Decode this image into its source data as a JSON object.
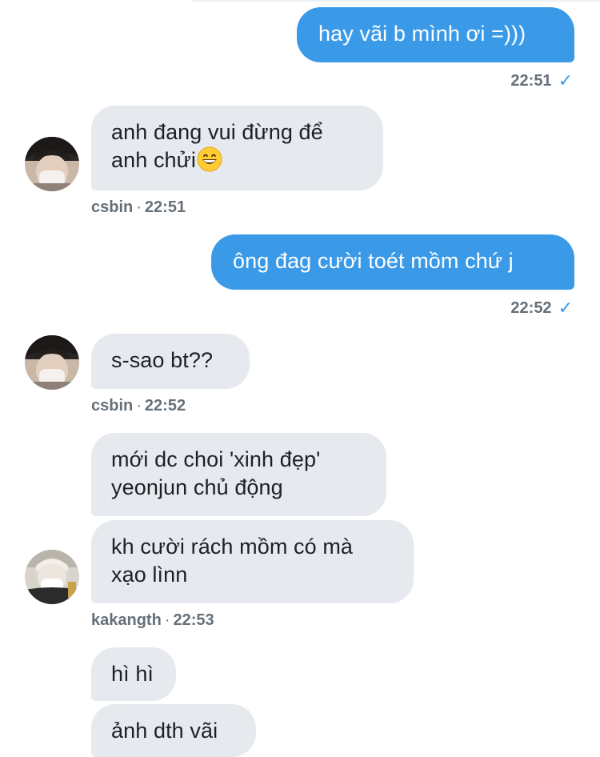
{
  "colors": {
    "outgoing_bubble": "#3b9ae8",
    "incoming_bubble": "#e6e9ee",
    "meta_text": "#667079",
    "read_check": "#3b9ae8"
  },
  "messages": [
    {
      "direction": "out",
      "text": "hay vãi b mình ơi =)))",
      "time": "22:51",
      "status_icon": "check-icon"
    },
    {
      "direction": "in",
      "line1": "anh đang vui đừng để",
      "line2": "anh chửi",
      "emoji": "grinning-face-emoji",
      "sender": "csbin",
      "time": "22:51",
      "separator": "·"
    },
    {
      "direction": "out",
      "text": "ông đag cười toét mồm chứ j",
      "time": "22:52",
      "status_icon": "check-icon"
    },
    {
      "direction": "in",
      "text": "s-sao bt??",
      "sender": "csbin",
      "time": "22:52",
      "separator": "·"
    },
    {
      "direction": "in",
      "line1": "mới dc choi 'xinh đẹp'",
      "line2": "yeonjun chủ động"
    },
    {
      "direction": "in",
      "line1": "kh cười rách mồm có mà",
      "line2": "xạo lìnn",
      "sender": "kakangth",
      "time": "22:53",
      "separator": "·"
    },
    {
      "direction": "in",
      "text": "hì hì"
    },
    {
      "direction": "in",
      "text": "ảnh dth vãi"
    }
  ]
}
